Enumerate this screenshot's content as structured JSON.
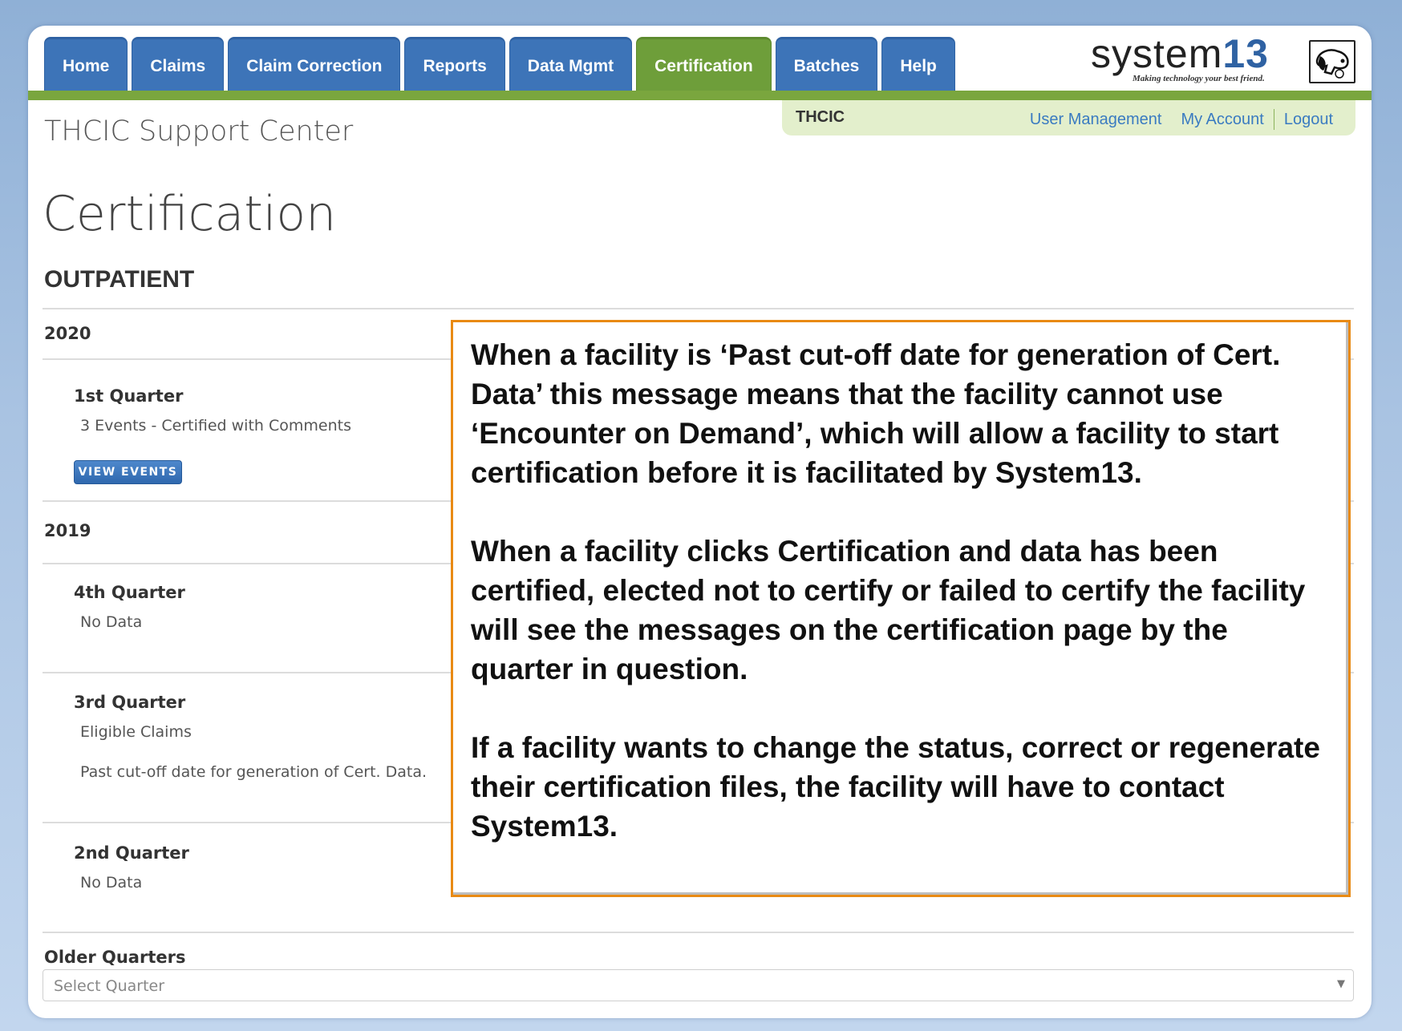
{
  "nav": {
    "tabs": [
      {
        "label": "Home",
        "active": false
      },
      {
        "label": "Claims",
        "active": false
      },
      {
        "label": "Claim Correction",
        "active": false
      },
      {
        "label": "Reports",
        "active": false
      },
      {
        "label": "Data Mgmt",
        "active": false
      },
      {
        "label": "Certification",
        "active": true
      },
      {
        "label": "Batches",
        "active": false
      },
      {
        "label": "Help",
        "active": false
      }
    ]
  },
  "logo": {
    "word_main": "system",
    "word_num": "13",
    "tagline": "Making technology your best friend."
  },
  "utility": {
    "org": "THCIC",
    "user_management": "User Management",
    "my_account": "My Account",
    "logout": "Logout"
  },
  "site_title": "THCIC Support Center",
  "page_title": "Certification",
  "section_title": "OUTPATIENT",
  "years": [
    {
      "year": "2020",
      "quarters": [
        {
          "title": "1st Quarter",
          "lines": [
            "3 Events - Certified with Comments"
          ],
          "button": "VIEW EVENTS"
        }
      ]
    },
    {
      "year": "2019",
      "quarters": [
        {
          "title": "4th Quarter",
          "lines": [
            "No Data"
          ]
        },
        {
          "title": "3rd Quarter",
          "lines": [
            "Eligible Claims",
            "Past cut-off date for generation of Cert. Data."
          ]
        },
        {
          "title": "2nd Quarter",
          "lines": [
            "No Data"
          ]
        }
      ]
    }
  ],
  "callout": {
    "paragraphs": [
      "When a facility is ‘Past cut-off date for generation of Cert. Data’ this message means that the facility cannot use ‘Encounter on Demand’, which will allow a facility to start certification before it is facilitated by System13.",
      "When a facility clicks Certification and data has been certified, elected not to certify or failed to certify the facility will see the messages on the certification page by the quarter in question.",
      "If a facility wants to change the status, correct or regenerate their certification files, the facility will have to contact System13."
    ]
  },
  "older_quarters": {
    "label": "Older Quarters",
    "placeholder": "Select Quarter"
  },
  "colors": {
    "tab_blue": "#3d74b8",
    "tab_active_green": "#6e9e3a",
    "link_blue": "#3a7bc1",
    "callout_border": "#e98a14"
  }
}
